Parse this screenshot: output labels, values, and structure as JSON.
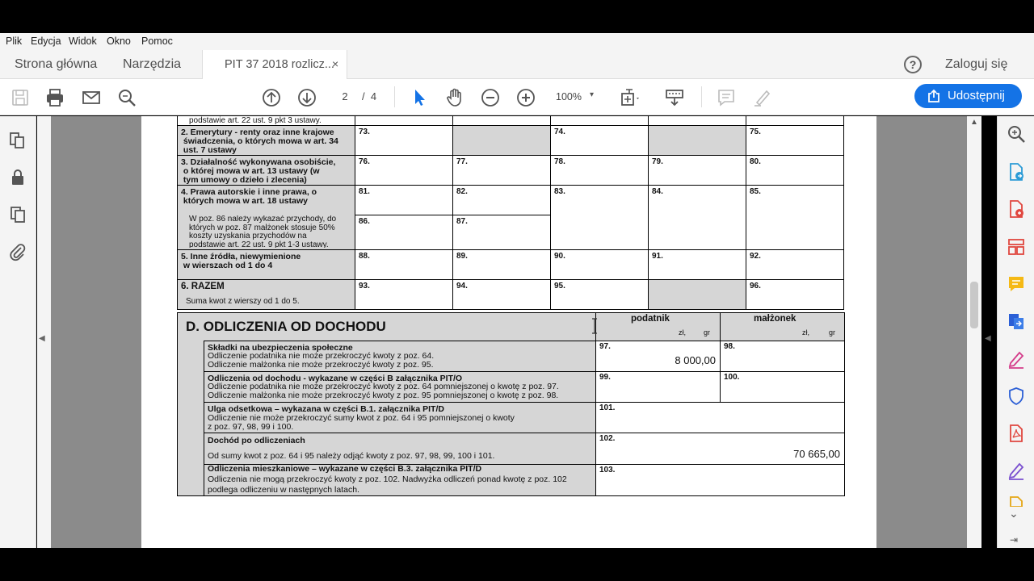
{
  "menu": [
    "Plik",
    "Edycja",
    "Widok",
    "Okno",
    "Pomoc"
  ],
  "tabs": {
    "home": "Strona główna",
    "tools": "Narzędzia",
    "doc": "PIT 37 2018 rozlicz...",
    "close": "×"
  },
  "help": "?",
  "login": "Zaloguj się",
  "toolbar": {
    "page_current": "2",
    "page_sep": "/",
    "page_total": "4",
    "zoom": "100%",
    "zoom_dd": "▾",
    "share": "Udostępnij"
  },
  "colors": {
    "accent": "#1473e6",
    "canvas": "#8b8b8b",
    "grey_cell": "#d6d6d6"
  },
  "section_c": {
    "top_cut": "podstawie art. 22 ust. 9 pkt 3 ustawy.",
    "rows": [
      {
        "label": "2. Emerytury - renty oraz inne krajowe\n świadczenia, o których mowa w art. 34\n ust. 7 ustawy",
        "nums": [
          "73.",
          "",
          "74.",
          "",
          "75."
        ]
      },
      {
        "label": "3. Działalność wykonywana osobiście,\n o której mowa w art. 13 ustawy (w\n tym umowy o dzieło i zlecenia)",
        "nums": [
          "76.",
          "77.",
          "78.",
          "79.",
          "80."
        ]
      },
      {
        "label": "4. Prawa autorskie i inne prawa, o\n których mowa w art. 18 ustawy",
        "nums": [
          "81.",
          "82.",
          "83.",
          "84.",
          "85."
        ],
        "note": "W poz. 86 należy wykazać przychody, do\nktórych w poz. 87 małżonek stosuje 50%\nkoszty uzyskania przychodów na\npodstawie art. 22 ust. 9 pkt 1-3 ustawy.",
        "sub_nums": [
          "86.",
          "87."
        ]
      },
      {
        "label": "5. Inne źródła, niewymienione\n w wierszach od 1 do 4",
        "nums": [
          "88.",
          "89.",
          "90.",
          "91.",
          "92."
        ]
      },
      {
        "label": "6. RAZEM",
        "sub": "Suma kwot z wierszy od 1 do 5.",
        "nums": [
          "93.",
          "94.",
          "95.",
          "",
          "96."
        ]
      }
    ]
  },
  "section_d": {
    "title": "D. ODLICZENIA OD DOCHODU",
    "col_podatnik": "podatnik",
    "col_malzonek": "małżonek",
    "zl": "zł,",
    "gr": "gr",
    "rows": [
      {
        "title": "Składki na ubezpieczenia społeczne",
        "text": "Odliczenie podatnika nie może przekroczyć kwoty z poz. 64.\nOdliczenie małżonka nie może przekroczyć kwoty z poz. 95.",
        "n1": "97.",
        "v1": "8 000,00",
        "n2": "98."
      },
      {
        "title": "Odliczenia od dochodu - wykazane w części B załącznika PIT/O",
        "text": "Odliczenie podatnika nie może przekroczyć kwoty z poz. 64 pomniejszonej o kwotę z poz. 97.\nOdliczenie małżonka nie może przekroczyć kwoty z poz. 95 pomniejszonej o kwotę z poz. 98.",
        "n1": "99.",
        "n2": "100."
      },
      {
        "title": "Ulga odsetkowa – wykazana w części B.1. załącznika PIT/D",
        "text": "Odliczenie nie może przekroczyć sumy kwot z poz. 64 i 95 pomniejszonej o kwoty\nz poz. 97, 98, 99 i 100.",
        "n1": "101."
      },
      {
        "title": "Dochód po odliczeniach",
        "text": "Od sumy kwot z poz. 64 i 95 należy odjąć kwoty z poz. 97, 98, 99, 100 i 101.",
        "n1": "102.",
        "v1": "70 665,00"
      },
      {
        "title": "Odliczenia mieszkaniowe – wykazane w części B.3. załącznika PIT/D",
        "text": "Odliczenia nie mogą przekroczyć kwoty z poz. 102. Nadwyżka odliczeń ponad kwotę z poz. 102\npodlega odliczeniu w następnych latach.",
        "n1": "103."
      }
    ]
  }
}
